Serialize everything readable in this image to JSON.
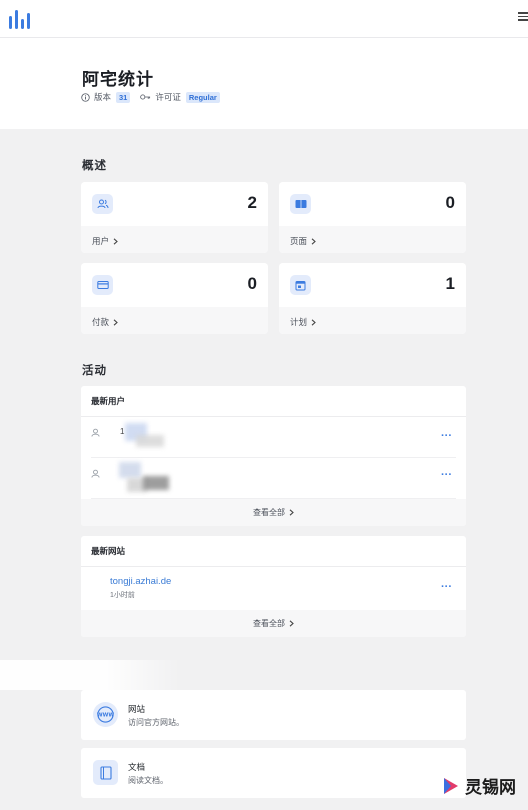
{
  "header": {
    "logo_icon": "bar-chart-logo-icon",
    "menu_icon": "hamburger-menu-icon"
  },
  "site": {
    "title": "阿宅统计",
    "version_label": "版本",
    "version_value": "31",
    "license_label": "许可证",
    "license_value": "Regular"
  },
  "overview": {
    "title": "概述",
    "cards": [
      {
        "icon": "users-icon",
        "value": "2",
        "label": "用户"
      },
      {
        "icon": "pages-icon",
        "value": "0",
        "label": "页面"
      },
      {
        "icon": "payment-card-icon",
        "value": "0",
        "label": "付款"
      },
      {
        "icon": "calendar-plan-icon",
        "value": "1",
        "label": "计划"
      }
    ]
  },
  "activity": {
    "title": "活动",
    "latest_users": {
      "title": "最新用户",
      "rows": [
        {
          "name": "1",
          "more": "···"
        },
        {
          "name": "",
          "more": "···"
        }
      ],
      "view_all": "查看全部"
    },
    "latest_sites": {
      "title": "最新网站",
      "rows": [
        {
          "host": "tongji.azhai.de",
          "time": "1小时前",
          "more": "···"
        }
      ],
      "view_all": "查看全部"
    }
  },
  "links": [
    {
      "icon": "www-globe-icon",
      "title": "网站",
      "desc": "访问官方网站。"
    },
    {
      "icon": "docs-book-icon",
      "title": "文档",
      "desc": "阅读文档。"
    }
  ],
  "watermark": {
    "text": "灵锡网"
  },
  "colors": {
    "accent": "#3a7bd5",
    "icon_bg": "#e3ebfb",
    "badge_bg": "#dbe7fb",
    "page_bg": "#f1f1f2"
  }
}
